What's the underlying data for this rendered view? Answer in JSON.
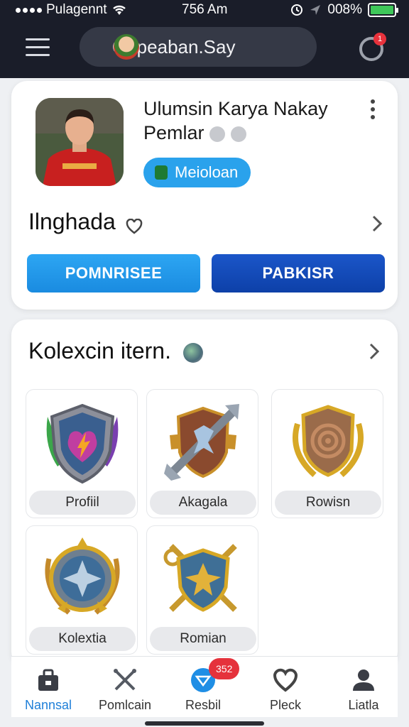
{
  "status_bar": {
    "carrier": "Pulagennt",
    "time": "756 Am",
    "battery": "008%",
    "battery_level": 1.0,
    "battery_color": "#3fc85a"
  },
  "header": {
    "search_text": "Qnpeaban.Say",
    "notification_count": "1"
  },
  "profile": {
    "name": "Ulumsin Karya Nakay Pemlar",
    "status_chip": "Meioloan",
    "row_label": "Ilnghada",
    "primary_button": "POMNRISEE",
    "secondary_button": "PABKISR"
  },
  "collection": {
    "title": "Kolexcin itern.",
    "items": [
      {
        "label": "Profiil",
        "icon": "heart-shield-icon"
      },
      {
        "label": "Akagala",
        "icon": "axe-shield-icon"
      },
      {
        "label": "Rowisn",
        "icon": "laurel-emblem-icon"
      },
      {
        "label": "Kolextia",
        "icon": "star-shield-icon"
      },
      {
        "label": "Romian",
        "icon": "crossed-swords-icon"
      }
    ]
  },
  "bottom_nav": {
    "items": [
      {
        "label": "Nannsal",
        "icon": "bag-icon",
        "active": true
      },
      {
        "label": "Pomlcain",
        "icon": "crossed-tools-icon",
        "active": false
      },
      {
        "label": "Resbil",
        "icon": "chat-icon",
        "active": false
      },
      {
        "label": "Pleck",
        "icon": "heart-icon",
        "active": false
      },
      {
        "label": "Liatla",
        "icon": "user-icon",
        "active": false
      }
    ],
    "badge": "352"
  },
  "colors": {
    "accent": "#2aa2ec",
    "primary_button": "#1a8be0",
    "secondary_button": "#0d40a8",
    "active_nav": "#1f7fd8"
  }
}
